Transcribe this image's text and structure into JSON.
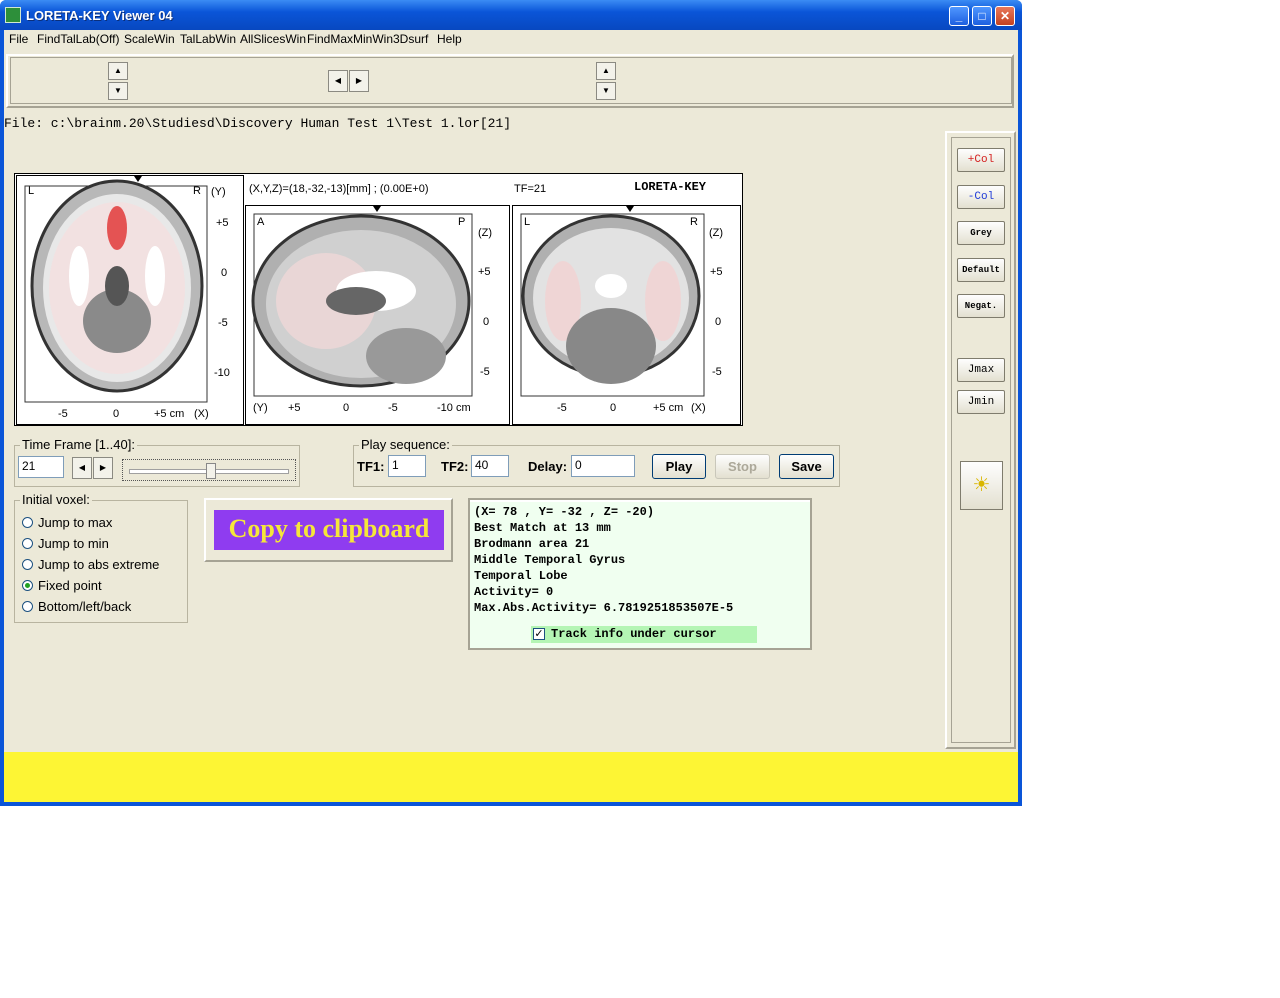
{
  "window": {
    "title": "LORETA-KEY Viewer 04",
    "min": "_",
    "max": "□",
    "close": "✕"
  },
  "menu": [
    "File",
    "FindTalLab(Off)",
    "ScaleWin",
    "TalLabWin",
    "AllSlicesWin",
    "FindMaxMinWin",
    "3Dsurf",
    "Help"
  ],
  "file_path": "File: c:\\brainm.20\\Studiesd\\Discovery Human Test 1\\Test 1.lor[21]",
  "image_panel": {
    "coords": "(X,Y,Z)=(18,-32,-13)[mm] ; (0.00E+0)",
    "tf": "TF=21",
    "brand": "LORETA-KEY",
    "axial": {
      "corner_left": "L",
      "corner_right": "R",
      "axis_label": "(Y)",
      "right_ticks": [
        "+5",
        "0",
        "-5",
        "-10"
      ],
      "bottom_ticks": [
        "-5",
        "0",
        "+5 cm",
        "(X)"
      ]
    },
    "sagittal": {
      "corner_left": "A",
      "corner_right": "P",
      "axis_label": "(Z)",
      "right_ticks": [
        "+5",
        "0",
        "-5"
      ],
      "bottom_ticks": [
        "(Y)",
        "+5",
        "0",
        "-5",
        "-10 cm"
      ]
    },
    "coronal": {
      "corner_left": "L",
      "corner_right": "R",
      "axis_label": "(Z)",
      "right_ticks": [
        "+5",
        "0",
        "-5"
      ],
      "bottom_ticks": [
        "-5",
        "0",
        "+5 cm",
        "(X)"
      ]
    }
  },
  "time_frame": {
    "legend": "Time Frame [1..40]:",
    "value": "21",
    "slider_fraction": 0.513
  },
  "play": {
    "legend": "Play sequence:",
    "tf1_label": "TF1:",
    "tf1_value": "1",
    "tf2_label": "TF2:",
    "tf2_value": "40",
    "delay_label": "Delay:",
    "delay_value": "0",
    "play": "Play",
    "stop": "Stop",
    "save": "Save"
  },
  "initial_voxel": {
    "legend": "Initial voxel:",
    "options": [
      "Jump to max",
      "Jump to min",
      "Jump to abs extreme",
      "Fixed point",
      "Bottom/left/back"
    ],
    "selected_index": 3
  },
  "copy_button": "Copy to clipboard",
  "info": {
    "lines": [
      "(X= 78 , Y= -32 , Z= -20)",
      "Best Match at 13 mm",
      "Brodmann area 21",
      "Middle Temporal Gyrus",
      "Temporal Lobe",
      "Activity= 0",
      "Max.Abs.Activity= 6.7819251853507E-5"
    ],
    "track_label": "Track info under cursor",
    "track_checked": true
  },
  "side_buttons": {
    "plus_col": "+Col",
    "minus_col": "-Col",
    "grey": "Grey",
    "default": "Default",
    "negat": "Negat.",
    "jmax": "Jmax",
    "jmin": "Jmin"
  },
  "colors": {
    "accent_purple": "#8f3cf0",
    "copy_text": "#f5e63a",
    "status_bar": "#fdf534",
    "titlebar": "#0a55d8"
  }
}
